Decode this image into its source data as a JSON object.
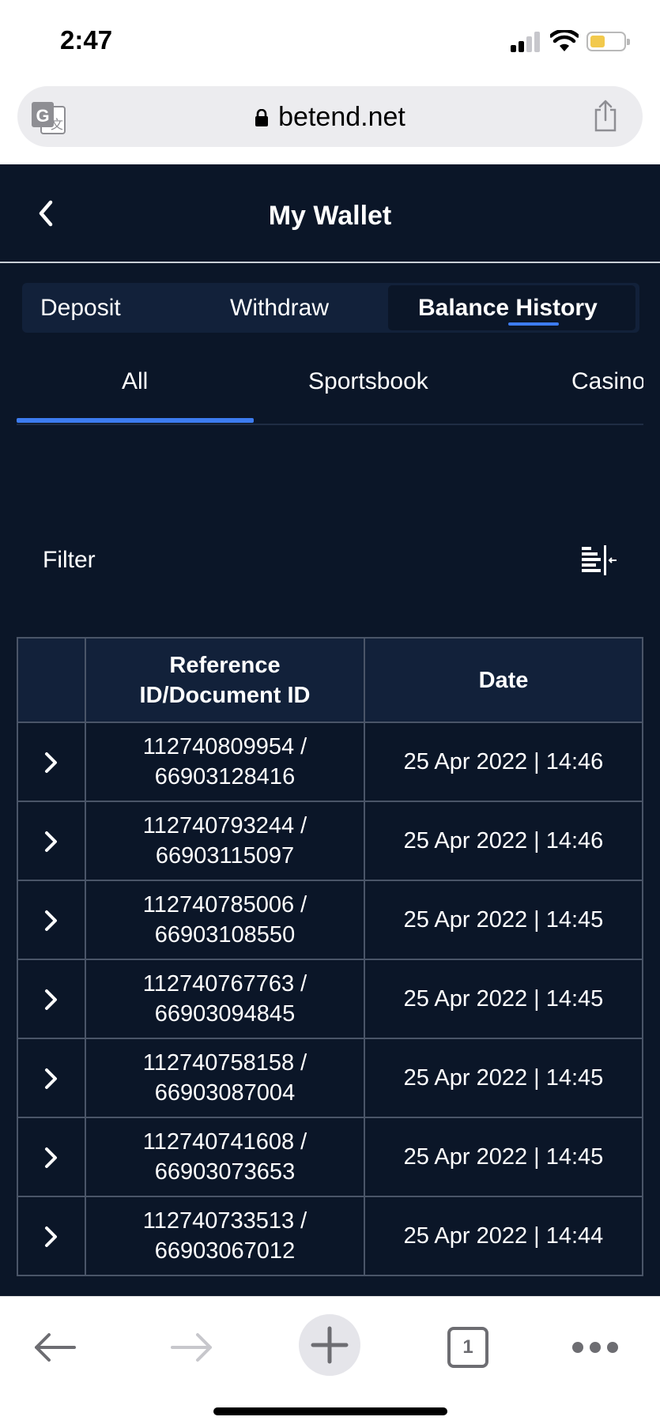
{
  "status_bar": {
    "time": "2:47"
  },
  "browser": {
    "url": "betend.net"
  },
  "header": {
    "title": "My Wallet"
  },
  "segment_tabs": [
    {
      "label": "Deposit",
      "active": false
    },
    {
      "label": "Withdraw",
      "active": false
    },
    {
      "label": "Balance History",
      "active": true
    }
  ],
  "sub_tabs": [
    {
      "label": "All",
      "active": true
    },
    {
      "label": "Sportsbook",
      "active": false
    },
    {
      "label": "Casino",
      "active": false
    }
  ],
  "filter": {
    "label": "Filter"
  },
  "table": {
    "headers": {
      "reference": "Reference\nID/Document ID",
      "date": "Date"
    },
    "rows": [
      {
        "ref": "112740809954 /",
        "doc": "66903128416",
        "date": "25 Apr 2022 | 14:46"
      },
      {
        "ref": "112740793244 /",
        "doc": "66903115097",
        "date": "25 Apr 2022 | 14:46"
      },
      {
        "ref": "112740785006 /",
        "doc": "66903108550",
        "date": "25 Apr 2022 | 14:45"
      },
      {
        "ref": "112740767763 /",
        "doc": "66903094845",
        "date": "25 Apr 2022 | 14:45"
      },
      {
        "ref": "112740758158 /",
        "doc": "66903087004",
        "date": "25 Apr 2022 | 14:45"
      },
      {
        "ref": "112740741608 /",
        "doc": "66903073653",
        "date": "25 Apr 2022 | 14:45"
      },
      {
        "ref": "112740733513 /",
        "doc": "66903067012",
        "date": "25 Apr 2022 | 14:44"
      }
    ]
  },
  "bottom_bar": {
    "tab_count": "1"
  },
  "colors": {
    "app_background": "#0b1628",
    "panel": "#12213a",
    "accent": "#3d7cf0",
    "text": "#ffffff",
    "grid_border": "#4a5568"
  }
}
